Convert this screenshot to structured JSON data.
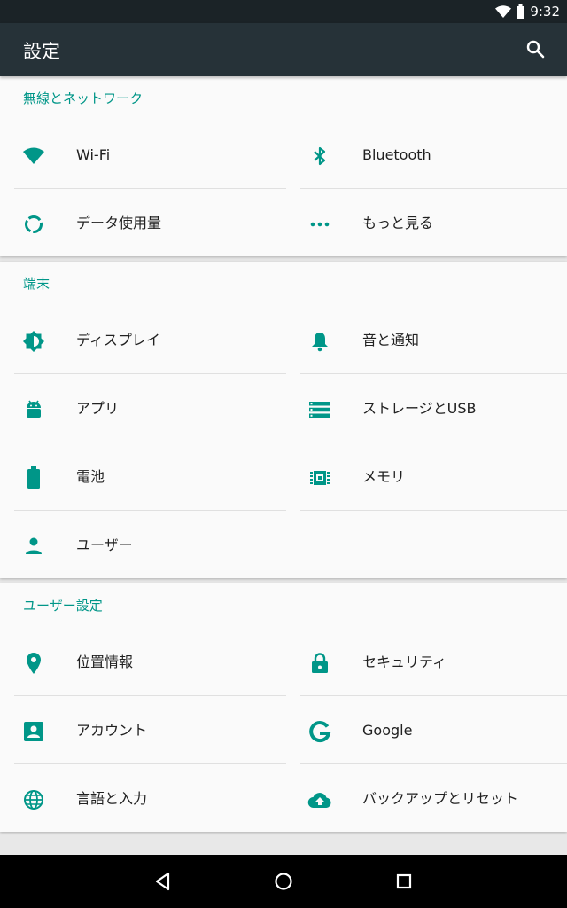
{
  "status": {
    "time": "9:32",
    "accent": "#009688"
  },
  "appbar": {
    "title": "設定",
    "search_icon": "search-icon"
  },
  "sections": {
    "wireless": {
      "title": "無線とネットワーク",
      "items": [
        {
          "label": "Wi-Fi",
          "icon": "wifi-icon"
        },
        {
          "label": "Bluetooth",
          "icon": "bluetooth-icon"
        },
        {
          "label": "データ使用量",
          "icon": "data-usage-icon"
        },
        {
          "label": "もっと見る",
          "icon": "more-dots-icon"
        }
      ]
    },
    "device": {
      "title": "端末",
      "items": [
        {
          "label": "ディスプレイ",
          "icon": "display-brightness-icon"
        },
        {
          "label": "音と通知",
          "icon": "bell-icon"
        },
        {
          "label": "アプリ",
          "icon": "android-icon"
        },
        {
          "label": "ストレージとUSB",
          "icon": "storage-icon"
        },
        {
          "label": "電池",
          "icon": "battery-icon"
        },
        {
          "label": "メモリ",
          "icon": "memory-icon"
        },
        {
          "label": "ユーザー",
          "icon": "person-icon"
        }
      ]
    },
    "personal": {
      "title": "ユーザー設定",
      "items": [
        {
          "label": "位置情報",
          "icon": "location-pin-icon"
        },
        {
          "label": "セキュリティ",
          "icon": "lock-icon"
        },
        {
          "label": "アカウント",
          "icon": "account-box-icon"
        },
        {
          "label": "Google",
          "icon": "google-icon"
        },
        {
          "label": "言語と入力",
          "icon": "globe-icon"
        },
        {
          "label": "バックアップとリセット",
          "icon": "cloud-upload-icon"
        }
      ]
    }
  },
  "navbar": {
    "back_icon": "back-triangle-icon",
    "home_icon": "home-circle-icon",
    "recents_icon": "recents-square-icon"
  }
}
